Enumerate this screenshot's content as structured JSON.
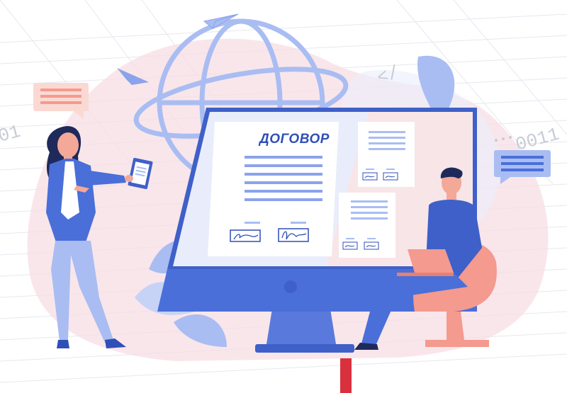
{
  "illustration": {
    "document_title": "ДОГОВОР",
    "decorative_code": [
      "</",
      "01",
      "0011"
    ]
  },
  "colors": {
    "primary_blue": "#4a6fd8",
    "dark_blue": "#2f4fb8",
    "light_blue": "#a9bdf2",
    "pink_bg": "#f7dde4",
    "coral": "#f49a8e",
    "signature_blue": "#2f4fb8"
  }
}
